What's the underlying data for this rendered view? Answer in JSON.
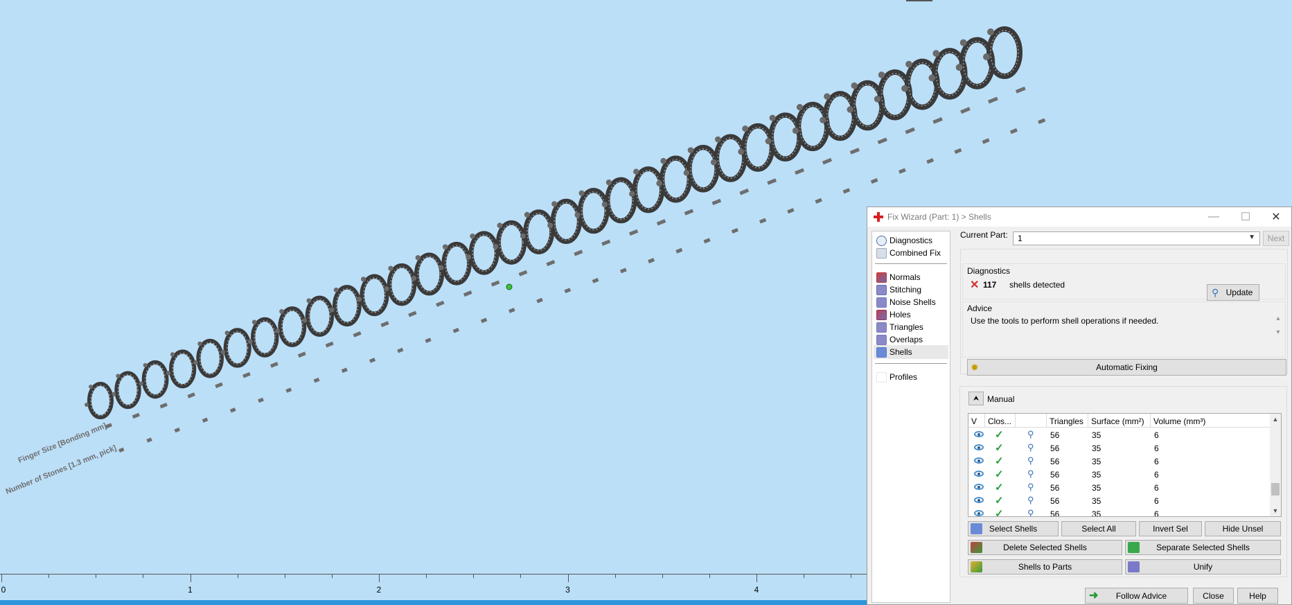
{
  "viewport": {
    "ruler": {
      "labels": [
        "0",
        "1",
        "2",
        "3",
        "4"
      ]
    },
    "row_labels": [
      "Finger Size [Bonding mm]",
      "Number of Stones [1.3 mm, pick]"
    ]
  },
  "dialog": {
    "title": "Fix Wizard (Part: 1) > Shells",
    "window_controls": {
      "minimize": "—",
      "maximize": "☐",
      "close": "✕"
    },
    "nav": {
      "items": [
        {
          "label": "Diagnostics",
          "icon": "magnifier-icon",
          "color": "#4a6fa8"
        },
        {
          "label": "Combined Fix",
          "icon": "combined-fix-icon",
          "color": "#9aa8c0"
        },
        {
          "label": "Normals",
          "icon": "normals-icon",
          "color": "#c03030"
        },
        {
          "label": "Stitching",
          "icon": "stitching-icon",
          "color": "#6b6bb0"
        },
        {
          "label": "Noise Shells",
          "icon": "noise-shells-icon",
          "color": "#7a7ab8"
        },
        {
          "label": "Holes",
          "icon": "holes-icon",
          "color": "#a03050"
        },
        {
          "label": "Triangles",
          "icon": "triangles-icon",
          "color": "#7a7ab8"
        },
        {
          "label": "Overlaps",
          "icon": "overlaps-icon",
          "color": "#7a7ab8"
        },
        {
          "label": "Shells",
          "icon": "shells-icon",
          "color": "#5a7ac8",
          "selected": true
        },
        {
          "label": "Profiles",
          "icon": "profiles-icon",
          "color": "#e0e8f0"
        }
      ]
    },
    "current_part": {
      "label": "Current Part:",
      "value": "1",
      "next_label": "Next"
    },
    "diagnostics": {
      "title": "Diagnostics",
      "count": "117",
      "message": "shells detected",
      "update_label": "Update"
    },
    "advice": {
      "title": "Advice",
      "text": "Use the tools to perform shell operations if needed."
    },
    "automatic_fixing_label": "Automatic Fixing",
    "manual": {
      "title": "Manual",
      "columns": [
        "V",
        "Clos...",
        "",
        "Triangles",
        "Surface (mm²)",
        "Volume (mm³)"
      ],
      "rows": [
        {
          "triangles": "56",
          "surface": "35",
          "volume": "6"
        },
        {
          "triangles": "56",
          "surface": "35",
          "volume": "6"
        },
        {
          "triangles": "56",
          "surface": "35",
          "volume": "6"
        },
        {
          "triangles": "56",
          "surface": "35",
          "volume": "6"
        },
        {
          "triangles": "56",
          "surface": "35",
          "volume": "6"
        },
        {
          "triangles": "56",
          "surface": "35",
          "volume": "6"
        },
        {
          "triangles": "56",
          "surface": "35",
          "volume": "6"
        }
      ],
      "buttons": {
        "select_shells": "Select Shells",
        "select_all": "Select All",
        "invert_sel": "Invert Sel",
        "hide_unsel": "Hide Unsel",
        "delete_selected": "Delete Selected Shells",
        "separate_selected": "Separate Selected Shells",
        "shells_to_parts": "Shells to Parts",
        "unify": "Unify"
      }
    },
    "footer": {
      "follow_advice": "Follow Advice",
      "close": "Close",
      "help": "Help"
    }
  }
}
